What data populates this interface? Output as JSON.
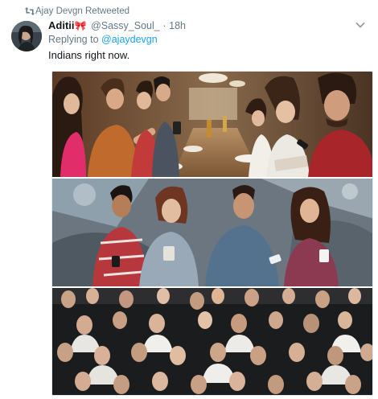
{
  "retweet": {
    "label": "Ajay Devgn Retweeted",
    "icon": "retweet-icon"
  },
  "author": {
    "name": "Aditii",
    "name_emoji": "🎀",
    "handle": "@Sassy_Soul_",
    "separator": "·",
    "time": "18h"
  },
  "reply": {
    "prefix": "Replying to",
    "mention": "@ajaydevgn"
  },
  "tweet": {
    "text": "Indians right now."
  },
  "colors": {
    "link": "#1da1f2",
    "muted": "#657786",
    "text": "#14171a",
    "emoji": "#d8202f"
  },
  "media": {
    "panels": [
      "people-at-restaurant-table-phones-photo",
      "people-with-phones-graffiti-wall-photo",
      "crowd-business-people-on-phones-photo"
    ]
  }
}
